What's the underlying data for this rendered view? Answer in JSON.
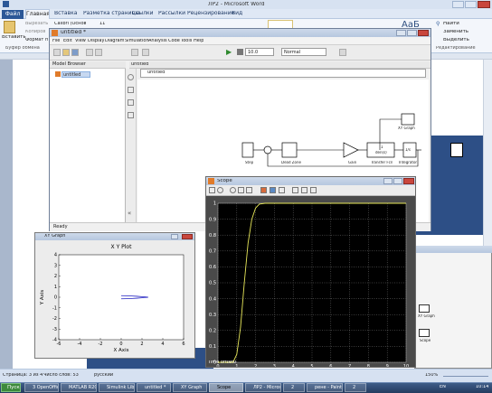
{
  "word": {
    "title": "ЛР2 - Microsoft Word",
    "file_tab": "Файл",
    "tabs": [
      "Главная",
      "Вставка",
      "Разметка страницы",
      "Ссылки",
      "Рассылки",
      "Рецензирование",
      "Вид"
    ],
    "clipboard": {
      "paste": "Вставить",
      "cut": "Вырезать",
      "copy": "Копиров",
      "format": "Формат п",
      "group": "Буфер обмена"
    },
    "font_name": "Calibri (Основ",
    "font_size": "11",
    "edit_group": {
      "find": "Найти",
      "replace": "Заменить",
      "select": "Выделить",
      "label": "Редактирование"
    },
    "status": {
      "page": "Страница: 3 из 4",
      "words": "Число слов: 53",
      "language": "русский",
      "zoom": "150%"
    }
  },
  "simulink": {
    "title": "untitled *",
    "menu": [
      "File",
      "Edit",
      "View",
      "Display",
      "Diagram",
      "Simulation",
      "Analysis",
      "Code",
      "Tools",
      "Help"
    ],
    "stop_time": "10.0",
    "mode": "Normal",
    "model_browser_label": "Model Browser",
    "tree_item": "untitled",
    "tab_label": "untitled",
    "breadcrumb": "untitled",
    "status": "Ready",
    "blocks": {
      "step": "Step",
      "dead_zone": "Dead Zone",
      "gain": "Gain",
      "tf": "Transfer Fcn",
      "tf_num": "1",
      "tf_den": "den(s)",
      "integrator": "Integrator",
      "integrator_sym": "1/s",
      "xy_graph": "XY Graph",
      "scope": "Scope"
    }
  },
  "xy_graph": {
    "window_title": "XY Graph",
    "plot_title": "X Y Plot",
    "xlabel": "X Axis",
    "ylabel": "Y Axis",
    "xticks": [
      "-6",
      "-4",
      "-2",
      "0",
      "2",
      "4",
      "6"
    ],
    "yticks": [
      "4",
      "3",
      "2",
      "1",
      "0",
      "-1",
      "-2",
      "-3",
      "-4"
    ]
  },
  "scope": {
    "window_title": "Scope",
    "yticks": [
      "1",
      "0.9",
      "0.8",
      "0.7",
      "0.6",
      "0.5",
      "0.4",
      "0.3",
      "0.2",
      "0.1",
      "0"
    ],
    "xticks": [
      "0",
      "1",
      "2",
      "3",
      "4",
      "5",
      "6",
      "7",
      "8",
      "9",
      "10"
    ],
    "time_offset_label": "Time offset:",
    "time_offset_value": "0"
  },
  "background_matlab": {
    "xy_label": "XY Graph",
    "scope_label": "Scope"
  },
  "taskbar": {
    "start": "Пуск",
    "items": [
      {
        "label": "3 OpenOffice...",
        "active": false
      },
      {
        "label": "MATLAB R2013b",
        "active": false
      },
      {
        "label": "Simulink Librar...",
        "active": false
      },
      {
        "label": "untitled *",
        "active": false
      },
      {
        "label": "XY Graph",
        "active": false
      },
      {
        "label": "Scope",
        "active": true
      },
      {
        "label": "ЛР2 - Microsof...",
        "active": false
      },
      {
        "label": "2",
        "active": false
      },
      {
        "label": "рене - Paint",
        "active": false
      },
      {
        "label": "2",
        "active": false
      }
    ],
    "lang": "EN",
    "time": "10:14"
  },
  "chart_data": [
    {
      "type": "line",
      "title": "",
      "xlabel": "",
      "ylabel": "",
      "xlim": [
        0,
        10
      ],
      "ylim": [
        0,
        1
      ],
      "grid": true,
      "series": [
        {
          "color": "#e8e85a",
          "x": [
            0,
            0.8,
            1.0,
            1.2,
            1.4,
            1.6,
            1.8,
            2.0,
            2.2,
            2.5,
            10
          ],
          "y": [
            0,
            0,
            0.05,
            0.22,
            0.5,
            0.75,
            0.9,
            0.97,
            0.995,
            1.0,
            1.0
          ]
        }
      ]
    },
    {
      "type": "line",
      "title": "X Y Plot",
      "xlabel": "X Axis",
      "ylabel": "Y Axis",
      "xlim": [
        -6,
        6
      ],
      "ylim": [
        -4,
        4
      ],
      "series": [
        {
          "color": "#2020c0",
          "x": [
            0,
            0.5,
            1.0,
            1.5,
            2.0,
            2.4,
            2.6,
            2.4,
            2.0,
            1.5,
            1.0,
            0.5,
            0
          ],
          "y": [
            0.15,
            0.14,
            0.12,
            0.09,
            0.05,
            0.02,
            0,
            -0.02,
            -0.05,
            -0.09,
            -0.12,
            -0.14,
            -0.15
          ]
        }
      ]
    }
  ]
}
